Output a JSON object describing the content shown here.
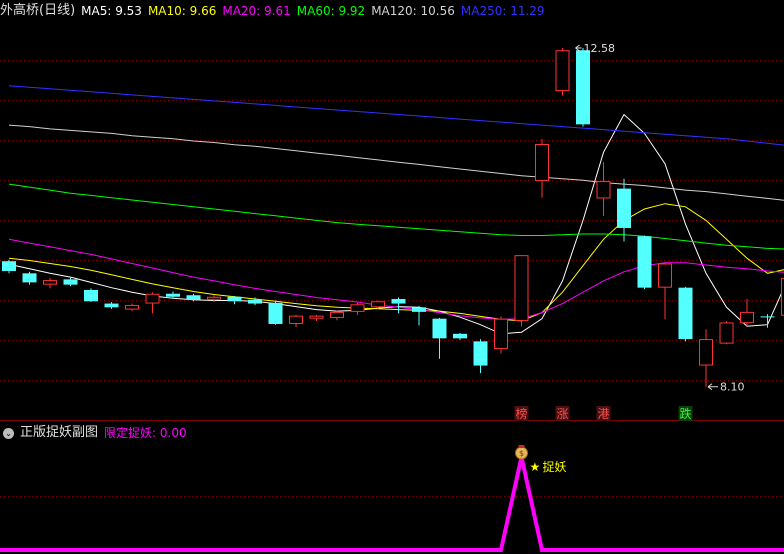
{
  "main_legend": {
    "title": "外高桥(日线)",
    "items": [
      {
        "text": "MA5: 9.53",
        "color": "#ffffff"
      },
      {
        "text": "MA10: 9.66",
        "color": "#ffff00"
      },
      {
        "text": "MA20: 9.61",
        "color": "#ff00ff"
      },
      {
        "text": "MA60: 9.92",
        "color": "#00ff00"
      },
      {
        "text": "MA120: 10.56",
        "color": "#d0d0d0"
      },
      {
        "text": "MA250: 11.29",
        "color": "#3232ff"
      }
    ]
  },
  "sub_legend": {
    "title": "正版捉妖副图",
    "value": {
      "text": "限定捉妖: 0.00",
      "color": "#ff00ff"
    }
  },
  "colors": {
    "up": "#ff3232",
    "down": "#54ffff",
    "grid": "#800000",
    "indicator": "#ff00ff",
    "star": "#ffff00"
  },
  "annotations": {
    "high_label": "12.58",
    "low_label": "8.10",
    "signal_label": "捉妖",
    "tags": [
      {
        "text": "榜",
        "color": "#ff5050",
        "bg": "#4a1010",
        "index": 25
      },
      {
        "text": "涨",
        "color": "#ff5050",
        "bg": "#4a1010",
        "index": 27
      },
      {
        "text": "港",
        "color": "#ff5050",
        "bg": "#4a1010",
        "index": 29
      },
      {
        "text": "跌",
        "color": "#33ff33",
        "bg": "#103a10",
        "index": 33
      }
    ]
  },
  "chart_data": {
    "type": "candlestick",
    "price_range": [
      7.66,
      12.95
    ],
    "candles": [
      {
        "o": 9.76,
        "c": 9.63,
        "h": 9.78,
        "l": 9.6
      },
      {
        "o": 9.6,
        "c": 9.48,
        "h": 9.62,
        "l": 9.45
      },
      {
        "o": 9.45,
        "c": 9.51,
        "h": 9.54,
        "l": 9.4
      },
      {
        "o": 9.52,
        "c": 9.45,
        "h": 9.55,
        "l": 9.43
      },
      {
        "o": 9.38,
        "c": 9.23,
        "h": 9.4,
        "l": 9.22
      },
      {
        "o": 9.2,
        "c": 9.15,
        "h": 9.22,
        "l": 9.13
      },
      {
        "o": 9.12,
        "c": 9.18,
        "h": 9.2,
        "l": 9.1
      },
      {
        "o": 9.2,
        "c": 9.33,
        "h": 9.35,
        "l": 9.07
      },
      {
        "o": 9.33,
        "c": 9.29,
        "h": 9.36,
        "l": 9.27
      },
      {
        "o": 9.31,
        "c": 9.25,
        "h": 9.33,
        "l": 9.23
      },
      {
        "o": 9.25,
        "c": 9.29,
        "h": 9.31,
        "l": 9.22
      },
      {
        "o": 9.29,
        "c": 9.23,
        "h": 9.3,
        "l": 9.19
      },
      {
        "o": 9.25,
        "c": 9.2,
        "h": 9.28,
        "l": 9.18
      },
      {
        "o": 9.21,
        "c": 8.93,
        "h": 9.24,
        "l": 8.92
      },
      {
        "o": 8.93,
        "c": 9.04,
        "h": 9.05,
        "l": 8.89
      },
      {
        "o": 9.0,
        "c": 9.04,
        "h": 9.05,
        "l": 8.97
      },
      {
        "o": 9.01,
        "c": 9.09,
        "h": 9.11,
        "l": 8.98
      },
      {
        "o": 9.09,
        "c": 9.19,
        "h": 9.21,
        "l": 9.05
      },
      {
        "o": 9.15,
        "c": 9.23,
        "h": 9.24,
        "l": 9.13
      },
      {
        "o": 9.26,
        "c": 9.2,
        "h": 9.28,
        "l": 9.07
      },
      {
        "o": 9.15,
        "c": 9.09,
        "h": 9.17,
        "l": 8.91
      },
      {
        "o": 9.0,
        "c": 8.74,
        "h": 9.01,
        "l": 8.47
      },
      {
        "o": 8.8,
        "c": 8.74,
        "h": 8.81,
        "l": 8.72
      },
      {
        "o": 8.7,
        "c": 8.38,
        "h": 8.73,
        "l": 8.28
      },
      {
        "o": 8.6,
        "c": 9.0,
        "h": 9.03,
        "l": 8.54
      },
      {
        "o": 8.97,
        "c": 9.84,
        "h": 9.84,
        "l": 8.9
      },
      {
        "o": 10.82,
        "c": 11.31,
        "h": 11.38,
        "l": 10.6
      },
      {
        "o": 12.01,
        "c": 12.55,
        "h": 12.58,
        "l": 11.95
      },
      {
        "o": 12.55,
        "c": 11.57,
        "h": 12.58,
        "l": 11.54
      },
      {
        "o": 10.59,
        "c": 10.82,
        "h": 11.07,
        "l": 10.36
      },
      {
        "o": 10.72,
        "c": 10.2,
        "h": 10.85,
        "l": 10.02
      },
      {
        "o": 10.09,
        "c": 9.41,
        "h": 10.1,
        "l": 9.39
      },
      {
        "o": 9.41,
        "c": 9.73,
        "h": 9.74,
        "l": 8.99
      },
      {
        "o": 9.41,
        "c": 8.73,
        "h": 9.42,
        "l": 8.7
      },
      {
        "o": 8.38,
        "c": 8.73,
        "h": 8.86,
        "l": 8.1
      },
      {
        "o": 8.67,
        "c": 8.95,
        "h": 8.97,
        "l": 8.66
      },
      {
        "o": 8.94,
        "c": 9.09,
        "h": 9.26,
        "l": 8.9
      },
      {
        "o": 9.03,
        "c": 9.02,
        "h": 9.06,
        "l": 8.88
      },
      {
        "o": 9.04,
        "c": 9.54,
        "h": 9.54,
        "l": 9.01
      }
    ],
    "ma_series": [
      {
        "name": "MA5",
        "color": "#ffffff",
        "values": [
          9.72,
          9.66,
          9.6,
          9.55,
          9.48,
          9.41,
          9.35,
          9.3,
          9.27,
          9.25,
          9.24,
          9.24,
          9.23,
          9.2,
          9.16,
          9.12,
          9.1,
          9.11,
          9.14,
          9.16,
          9.15,
          9.1,
          9.02,
          8.92,
          8.8,
          8.82,
          9.0,
          9.5,
          10.3,
          11.2,
          11.7,
          11.45,
          11.05,
          10.25,
          9.6,
          9.15,
          8.9,
          8.92,
          9.53
        ]
      },
      {
        "name": "MA10",
        "color": "#ffff00",
        "values": [
          9.8,
          9.77,
          9.73,
          9.69,
          9.64,
          9.58,
          9.52,
          9.46,
          9.41,
          9.36,
          9.32,
          9.29,
          9.26,
          9.23,
          9.2,
          9.17,
          9.15,
          9.14,
          9.13,
          9.12,
          9.11,
          9.1,
          9.07,
          9.03,
          8.99,
          8.97,
          9.08,
          9.35,
          9.7,
          10.05,
          10.3,
          10.45,
          10.52,
          10.48,
          10.3,
          10.05,
          9.8,
          9.6,
          9.66
        ]
      },
      {
        "name": "MA20",
        "color": "#ff00ff",
        "values": [
          10.05,
          10.0,
          9.95,
          9.9,
          9.85,
          9.79,
          9.73,
          9.67,
          9.61,
          9.55,
          9.5,
          9.45,
          9.4,
          9.36,
          9.32,
          9.28,
          9.25,
          9.22,
          9.18,
          9.15,
          9.12,
          9.08,
          9.04,
          9.01,
          8.99,
          9.0,
          9.08,
          9.2,
          9.35,
          9.5,
          9.62,
          9.7,
          9.74,
          9.74,
          9.71,
          9.68,
          9.66,
          9.63,
          9.61
        ]
      },
      {
        "name": "MA60",
        "color": "#00ff00",
        "values": [
          10.78,
          10.74,
          10.7,
          10.66,
          10.63,
          10.6,
          10.57,
          10.54,
          10.51,
          10.48,
          10.45,
          10.42,
          10.39,
          10.36,
          10.33,
          10.3,
          10.27,
          10.25,
          10.23,
          10.21,
          10.19,
          10.17,
          10.15,
          10.13,
          10.11,
          10.1,
          10.1,
          10.11,
          10.12,
          10.12,
          10.11,
          10.09,
          10.06,
          10.03,
          10.0,
          9.97,
          9.95,
          9.93,
          9.92
        ]
      },
      {
        "name": "MA120",
        "color": "#d0d0d0",
        "values": [
          11.56,
          11.54,
          11.51,
          11.49,
          11.47,
          11.45,
          11.42,
          11.4,
          11.38,
          11.35,
          11.33,
          11.3,
          11.28,
          11.25,
          11.22,
          11.19,
          11.16,
          11.13,
          11.1,
          11.07,
          11.04,
          11.01,
          10.98,
          10.95,
          10.92,
          10.89,
          10.87,
          10.85,
          10.83,
          10.8,
          10.78,
          10.76,
          10.73,
          10.7,
          10.68,
          10.65,
          10.62,
          10.59,
          10.56
        ]
      },
      {
        "name": "MA250",
        "color": "#3232ff",
        "values": [
          12.08,
          12.06,
          12.04,
          12.02,
          12.0,
          11.98,
          11.96,
          11.94,
          11.92,
          11.9,
          11.88,
          11.86,
          11.84,
          11.82,
          11.8,
          11.78,
          11.76,
          11.74,
          11.72,
          11.7,
          11.68,
          11.66,
          11.64,
          11.62,
          11.6,
          11.58,
          11.56,
          11.54,
          11.52,
          11.5,
          11.48,
          11.46,
          11.44,
          11.42,
          11.4,
          11.38,
          11.35,
          11.32,
          11.29
        ]
      }
    ],
    "indicator": {
      "name": "限定捉妖",
      "range": [
        0,
        1
      ],
      "values": [
        0,
        0,
        0,
        0,
        0,
        0,
        0,
        0,
        0,
        0,
        0,
        0,
        0,
        0,
        0,
        0,
        0,
        0,
        0,
        0,
        0,
        0,
        0,
        0,
        0,
        1,
        0,
        0,
        0,
        0,
        0,
        0,
        0,
        0,
        0,
        0,
        0,
        0,
        0
      ]
    }
  }
}
